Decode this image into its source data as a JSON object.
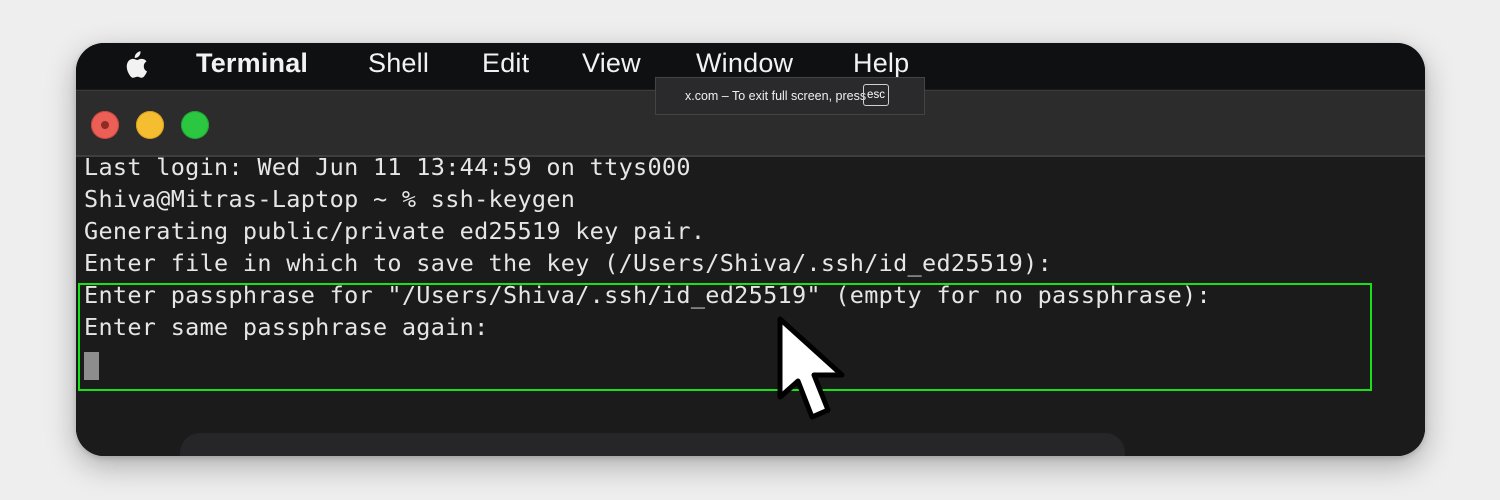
{
  "menubar": {
    "apple_icon": "apple-logo-icon",
    "items": [
      "Terminal",
      "Shell",
      "Edit",
      "View",
      "Window",
      "Help"
    ]
  },
  "fullscreen_banner": {
    "text": "x.com – To exit full screen, press",
    "key": "esc"
  },
  "terminal": {
    "lines": [
      "Last login: Wed Jun 11 13:44:59 on ttys000",
      "Shiva@Mitras-Laptop ~ % ssh-keygen",
      "Generating public/private ed25519 key pair.",
      "Enter file in which to save the key (/Users/Shiva/.ssh/id_ed25519):",
      "Enter passphrase for \"/Users/Shiva/.ssh/id_ed25519\" (empty for no passphrase):",
      "Enter same passphrase again:"
    ]
  },
  "colors": {
    "highlight_border": "#19e019",
    "traffic_red": "#ec5f57",
    "traffic_yellow": "#f4be30",
    "traffic_green": "#2bc740"
  },
  "icons": {
    "close": "close-window-icon",
    "minimize": "minimize-window-icon",
    "zoom": "zoom-window-icon",
    "pointer": "mouse-pointer-icon"
  }
}
